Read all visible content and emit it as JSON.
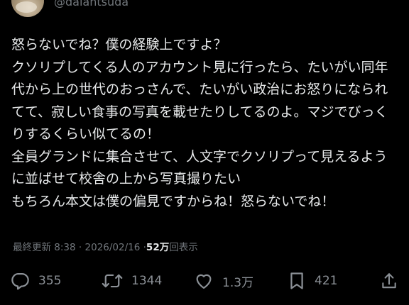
{
  "author": {
    "handle": "@daiantsuda"
  },
  "post": {
    "lines": [
      "怒らないでね？僕の経験上ですよ？",
      "クソリプしてくる人のアカウント見に行ったら、たいがい同年",
      "代から上の世代のおっさんで、たいがい政治にお怒りになられ",
      "てて、寂しい食事の写真を載せたりしてるのよ。マジでびっく",
      "りするくらい似てるの！",
      "全員グランドに集合させて、人文字でクソリプって見えるよう",
      "に並ばせて校舎の上から写真撮りたい",
      "もちろん本文は僕の偏見ですからね！怒らないでね！"
    ]
  },
  "meta": {
    "updated_label": "最終更新",
    "time": "8:38",
    "separator": "·",
    "date": "2026/02/16",
    "views_count": "52万",
    "views_label": "回表示"
  },
  "actions": {
    "replies": "355",
    "reposts": "1344",
    "likes": "1.3万",
    "bookmarks": "421"
  },
  "icons": {
    "reply": "reply-icon",
    "repost": "repost-icon",
    "like": "heart-icon",
    "bookmark": "bookmark-icon",
    "share": "share-icon"
  },
  "colors": {
    "background": "#000000",
    "text": "#e7e9ea",
    "secondary": "#71767b"
  }
}
